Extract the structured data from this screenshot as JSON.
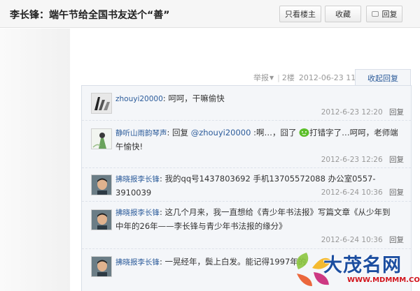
{
  "header": {
    "title": "李长锋：端午节给全国书友送个“善”",
    "only_author_label": "只看楼主",
    "favorite_label": "收藏",
    "reply_label": "回复"
  },
  "floor_meta": {
    "report_label": "举报",
    "floor": "2楼",
    "timestamp": "2012-06-23 11:23",
    "collapse_label": "收起回复"
  },
  "replies": [
    {
      "user": "zhouyi20000",
      "content": "呵呵，干嘛偷快",
      "time": "2012-6-23 12:20",
      "reply_label": "回复"
    },
    {
      "user": "静听山雨韵琴声",
      "content_prefix": "回复 ",
      "mention": "@zhouyi20000",
      "content_mid": " :啊…，囧了",
      "content_suffix": "打错字了…呵呵，老师端午愉快!",
      "time": "2012-6-23 12:26",
      "reply_label": "回复"
    },
    {
      "user": "拂晓报李长锋",
      "content": "我的qq号1437803692 手机13705572088 办公室0557-3910039",
      "time": "2012-6-24 10:36",
      "reply_label": "回复"
    },
    {
      "user": "拂晓报李长锋",
      "content": "这几个月来，我一直想给《青少年书法报》写篇文章《从少年到中年的26年——李长锋与青少年书法报的缘分》",
      "time": "2012-6-24 10:36",
      "reply_label": "回复"
    },
    {
      "user": "拂晓报李长锋",
      "content": "一晃经年，鬓上白发。能记得1997年的",
      "time": "",
      "reply_label": ""
    }
  ],
  "watermark": {
    "text": "大茂名网",
    "url": "WWW.MDMMM.COM"
  },
  "colors": {
    "link_blue": "#2b5b9a",
    "panel_bg": "#f4f6f9",
    "watermark_blue": "#1c4ea0",
    "watermark_red": "#d2141c"
  }
}
